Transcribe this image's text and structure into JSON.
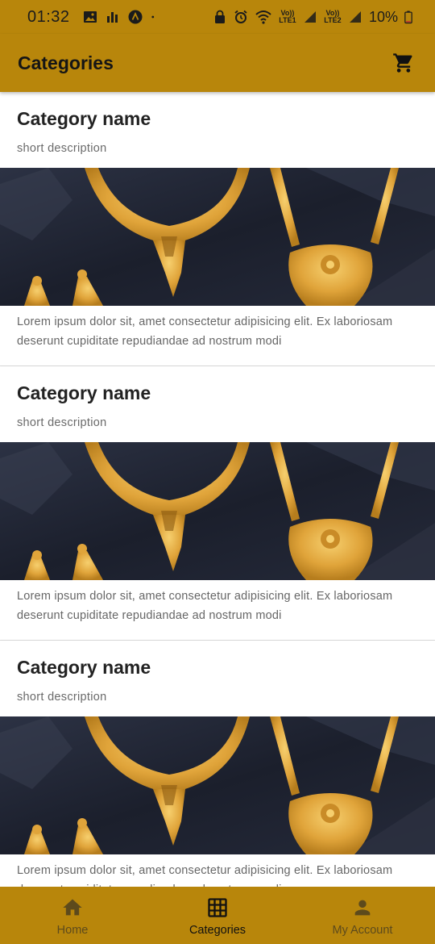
{
  "status_bar": {
    "time": "01:32",
    "battery": "10%",
    "volte1": "Vo)) LTE1",
    "volte2": "Vo)) LTE2"
  },
  "app_bar": {
    "title": "Categories",
    "cart_icon": "cart-icon"
  },
  "categories": [
    {
      "title": "Category name",
      "subtitle": "short description",
      "description": "Lorem ipsum dolor sit, amet consectetur adipisicing elit. Ex laboriosam deserunt cupiditate repudiandae ad nostrum modi"
    },
    {
      "title": "Category name",
      "subtitle": "short description",
      "description": "Lorem ipsum dolor sit, amet consectetur adipisicing elit. Ex laboriosam deserunt cupiditate repudiandae ad nostrum modi"
    },
    {
      "title": "Category name",
      "subtitle": "short description",
      "description": "Lorem ipsum dolor sit, amet consectetur adipisicing elit. Ex laboriosam deserunt cupiditate repudiandae ad nostrum modi"
    }
  ],
  "bottom_nav": {
    "items": [
      {
        "label": "Home",
        "icon": "home-icon",
        "active": false
      },
      {
        "label": "Categories",
        "icon": "grid-icon",
        "active": true
      },
      {
        "label": "My Account",
        "icon": "person-icon",
        "active": false
      }
    ]
  },
  "colors": {
    "accent": "#b8860b",
    "image_background": "#1f2333",
    "gold": "#e2a93a"
  }
}
